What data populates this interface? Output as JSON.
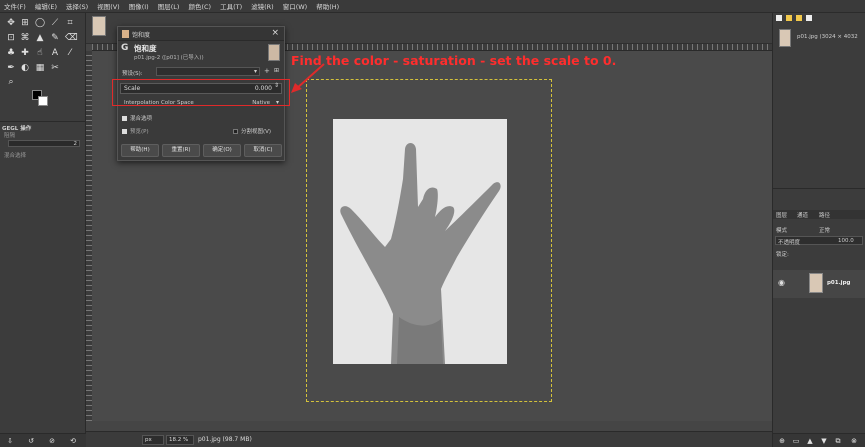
{
  "menubar": {
    "items": [
      "文件(F)",
      "编辑(E)",
      "选择(S)",
      "视图(V)",
      "图像(I)",
      "图层(L)",
      "颜色(C)",
      "工具(T)",
      "滤镜(R)",
      "窗口(W)",
      "帮助(H)"
    ]
  },
  "toolbox": {
    "gegl_header": "GEGL 操作",
    "field_value": "2",
    "option_small": "阻隔",
    "option_small2": "混合选择"
  },
  "dialog": {
    "title": "饱和度",
    "subtitle": "饱和度",
    "image_info": "p01.jpg-2 ([p01] (已导入))",
    "presets_label": "预设(S):",
    "scale_label": "Scale",
    "scale_value": "0.000",
    "interp_label": "Interpolation Color Space",
    "interp_value": "Native",
    "blend_options": "混合选项",
    "preview_label": "预览(P)",
    "split_view_label": "分割视图(V)",
    "buttons": {
      "help": "帮助(H)",
      "reset": "重置(R)",
      "ok": "确定(O)",
      "cancel": "取消(C)"
    }
  },
  "annotation": {
    "text": "Find the color - saturation - set the scale to 0."
  },
  "statusbar": {
    "unit": "px",
    "zoom": "18.2 %",
    "info": "p01.jpg (98.7 MB)"
  },
  "dock": {
    "image_label": "p01.jpg (3024 × 4032",
    "tabs": [
      "图层",
      "通道",
      "路径"
    ],
    "mode_label": "模式",
    "mode_value": "正常",
    "opacity_label": "不透明度",
    "opacity_value": "100.0",
    "lock_label": "锁定:",
    "layer_name": "p01.jpg"
  },
  "colors": {
    "annotation": "#e02a2a",
    "layer_boundary": "#d4c23b"
  }
}
